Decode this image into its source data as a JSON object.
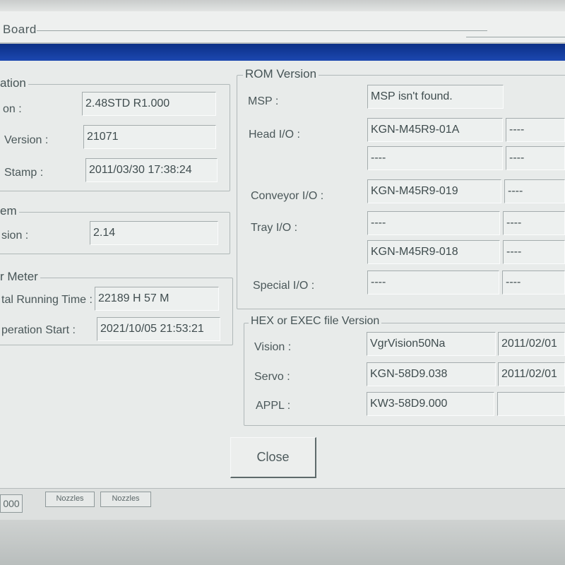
{
  "window": {
    "title": "Board"
  },
  "left": {
    "info_group": {
      "title": "ation",
      "rows": [
        {
          "label": "on :",
          "value": "2.48STD R1.000"
        },
        {
          "label": "Version :",
          "value": "21071"
        },
        {
          "label": "Stamp :",
          "value": "2011/03/30 17:38:24"
        }
      ]
    },
    "system_group": {
      "title": "em",
      "rows": [
        {
          "label": "sion :",
          "value": "2.14"
        }
      ]
    },
    "meter_group": {
      "title": "r Meter",
      "rows": [
        {
          "label": "tal Running Time :",
          "value": "22189 H 57 M"
        },
        {
          "label": "peration Start :",
          "value": "2021/10/05 21:53:21"
        }
      ]
    }
  },
  "rom": {
    "title": "ROM Version",
    "msp": {
      "label": "MSP :",
      "value": "MSP isn't found."
    },
    "head_io": {
      "label": "Head I/O :",
      "values": [
        "KGN-M45R9-01A",
        "----",
        "----",
        "----"
      ]
    },
    "conveyor_io": {
      "label": "Conveyor I/O :",
      "values": [
        "KGN-M45R9-019",
        "----"
      ]
    },
    "tray_io": {
      "label": "Tray I/O :",
      "values": [
        "----",
        "----",
        "KGN-M45R9-018",
        "----"
      ]
    },
    "special_io": {
      "label": "Special I/O :",
      "values": [
        "----",
        "----"
      ]
    }
  },
  "hex": {
    "title": "HEX or EXEC file Version",
    "rows": [
      {
        "label": "Vision :",
        "value": "VgrVision50Na",
        "date": "2011/02/01"
      },
      {
        "label": "Servo :",
        "value": "KGN-58D9.038",
        "date": "2011/02/01"
      },
      {
        "label": "APPL :",
        "value": "KW3-58D9.000",
        "date": ""
      }
    ]
  },
  "buttons": {
    "close": "Close"
  },
  "statusbar": {
    "tabs": [
      "000",
      "Nozzles",
      "Nozzles"
    ]
  }
}
